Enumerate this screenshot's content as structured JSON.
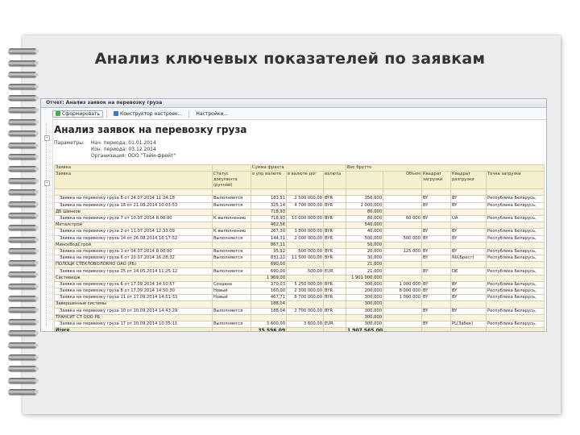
{
  "slide_title": "Анализ ключевых показателей по заявкам",
  "window": {
    "tab_prefix": "Отчет:",
    "tab_title": "Анализ заявок на перевозку груза"
  },
  "toolbar": {
    "generate_label": "Сформировать",
    "constructor_label": "Конструктор настроек...",
    "settings_label": "Настройки..."
  },
  "report": {
    "title": "Анализ заявок на перевозку груза",
    "params_label": "Параметры:",
    "params": [
      "Нач. периода: 01.01.2014",
      "Кон. периода: 03.12.2014",
      "Организация: ООО \"Тайм-фрейт\""
    ]
  },
  "table": {
    "header": {
      "c_orders": "Заявка",
      "c_order": "Заявка",
      "c_status": "Статус документа (ручной)",
      "c_freight": "Сумма фрахта",
      "c_in_agr": "в упр валюте",
      "c_in_cont": "в валюте дог",
      "c_currency": "валюта",
      "c_gross": "Вес брутто",
      "c_volume": "Объем",
      "c_load_sq": "Квадрат загрузки",
      "c_unload_sq": "Квадрат разгрузки",
      "c_load_pt": "Точка загрузки"
    },
    "rows": [
      {
        "type": "group",
        "name": "",
        "amount": "",
        "contract": "",
        "currency": "",
        "gross": "",
        "volume": "",
        "load": "",
        "unload": "",
        "point": ""
      },
      {
        "type": "item",
        "name": "Заявка на перевозку груза 8 от 24.07.2014 11:24:18",
        "status": "Выполняется",
        "amount": "183,51",
        "contract": "2 500 000,00",
        "currency": "BYR",
        "gross": "350,000",
        "volume": "",
        "load": "BY",
        "unload": "BY",
        "point": "Республика Беларусь,"
      },
      {
        "type": "item",
        "name": "Заявка на перевозку груза 16 от 21.08.2014 10:03:53",
        "status": "Выполняется",
        "amount": "325,14",
        "contract": "4 700 000,00",
        "currency": "BYR",
        "gross": "2 000,000",
        "volume": "",
        "load": "BY",
        "unload": "BY",
        "point": "Республика Беларусь,"
      },
      {
        "type": "group",
        "name": "ДБ Шенков",
        "amount": "718,93",
        "contract": "",
        "currency": "",
        "gross": "80,000",
        "volume": "",
        "load": "",
        "unload": "",
        "point": ""
      },
      {
        "type": "item",
        "name": "Заявка на перевозку груза 7 от 10.07.2014 8:00:00",
        "status": "К выполнению",
        "amount": "718,93",
        "contract": "10 000 000,00",
        "currency": "BYR",
        "gross": "80,000",
        "volume": "60 000",
        "load": "BY",
        "unload": "UA",
        "point": "Республика Беларусь,"
      },
      {
        "type": "group",
        "name": "Металстрой",
        "amount": "462,56",
        "contract": "",
        "currency": "",
        "gross": "540,000",
        "volume": "",
        "load": "",
        "unload": "",
        "point": ""
      },
      {
        "type": "item",
        "name": "Заявка на перевозку груза 2 от 11.07.2014 12:33:09",
        "status": "К выполнению",
        "amount": "267,30",
        "contract": "3 800 000,00",
        "currency": "BYR",
        "gross": "40,000",
        "volume": "",
        "load": "BY",
        "unload": "BY",
        "point": "Республика Беларусь,"
      },
      {
        "type": "item",
        "name": "Заявка на перевозку груза 14 от 26.08.2014 16:17:52",
        "status": "Выполняется",
        "amount": "144,31",
        "contract": "2 000 000,00",
        "currency": "BYR",
        "gross": "500,000",
        "volume": "500 000",
        "load": "BY",
        "unload": "BY",
        "point": "Республика Беларусь,"
      },
      {
        "type": "group",
        "name": "МинскВодСтрой",
        "amount": "867,11",
        "contract": "",
        "currency": "",
        "gross": "50,000",
        "volume": "",
        "load": "",
        "unload": "",
        "point": ""
      },
      {
        "type": "item",
        "name": "Заявка на перевозку груза 1 от 04.07.2014 8:00:00",
        "status": "Выполняется",
        "amount": "35,92",
        "contract": "500 000,00",
        "currency": "BYR",
        "gross": "20,000",
        "volume": "125 000",
        "load": "BY",
        "unload": "BY",
        "point": "Республика Беларусь,"
      },
      {
        "type": "item",
        "name": "Заявка на перевозку груза 6 от 20.07.2014 16:28:32",
        "status": "Выполняется",
        "amount": "831,22",
        "contract": "11 500 000,00",
        "currency": "BYR",
        "gross": "30,000",
        "volume": "",
        "load": "BY",
        "unload": "RU(Брест)",
        "point": "Республика Беларусь,"
      },
      {
        "type": "group",
        "name": "ПОЛОЦК СТЕКЛОВОЛОКНО ОАО (РБ)",
        "amount": "690,00",
        "contract": "",
        "currency": "",
        "gross": "21,000",
        "volume": "",
        "load": "",
        "unload": "",
        "point": ""
      },
      {
        "type": "item",
        "name": "Заявка на перевозку груза 25 от 14.05.2014 11:25:12",
        "status": "Выполняется",
        "amount": "690,00",
        "contract": "500,00",
        "currency": "EUR",
        "gross": "21,000",
        "volume": "",
        "load": "BY",
        "unload": "DE",
        "point": "Республика Беларусь,"
      },
      {
        "type": "group",
        "name": "Систевидж",
        "amount": "1 969,00",
        "contract": "",
        "currency": "",
        "gross": "1 901 000,000",
        "volume": "",
        "load": "",
        "unload": "",
        "point": ""
      },
      {
        "type": "item",
        "name": "Заявка на перевозку груза 6 от 17.09.2014 14:10:57",
        "status": "Создана",
        "amount": "370,03",
        "contract": "5 250 000,00",
        "currency": "BYR",
        "gross": "300,000",
        "volume": "1 000 000",
        "load": "BY",
        "unload": "BY",
        "point": "Республика Беларусь,"
      },
      {
        "type": "item",
        "name": "Заявка на перевозку груза 8 от 17.09.2014 14:50:30",
        "status": "Новый",
        "amount": "160,00",
        "contract": "2 300 000,00",
        "currency": "BYR",
        "gross": "200,000",
        "volume": "8 000 000",
        "load": "BY",
        "unload": "BY",
        "point": "Республика Беларусь,"
      },
      {
        "type": "item",
        "name": "Заявка на перевозку груза 11 от 17.09.2014 14:51:33",
        "status": "Новый",
        "amount": "467,71",
        "contract": "6 700 000,00",
        "currency": "BYR",
        "gross": "300,000",
        "volume": "1 000 000",
        "load": "BY",
        "unload": "BY",
        "point": "Республика Беларусь,"
      },
      {
        "type": "group",
        "name": "Завершенные системы",
        "amount": "188,04",
        "contract": "",
        "currency": "",
        "gross": "300,000",
        "volume": "",
        "load": "",
        "unload": "",
        "point": ""
      },
      {
        "type": "item",
        "name": "Заявка на перевозку груза 10 от 10.09.2014 14:43:29",
        "status": "Выполняется",
        "amount": "188,04",
        "contract": "2 700 000,00",
        "currency": "BYR",
        "gross": "300,000",
        "volume": "",
        "load": "BY",
        "unload": "BY",
        "point": "Республика Беларусь,"
      },
      {
        "type": "group",
        "name": "ТРАНСИТ СТ ООО РБ",
        "amount": "",
        "contract": "",
        "currency": "",
        "gross": "300,000",
        "volume": "",
        "load": "",
        "unload": "",
        "point": ""
      },
      {
        "type": "item",
        "name": "Заявка на перевозку груза 17 от 10.09.2014 10:35:11",
        "status": "Выполняется",
        "amount": "3 600,00",
        "contract": "3 600,00",
        "currency": "EUR",
        "gross": "300,000",
        "volume": "",
        "load": "BY",
        "unload": "PL(Забек)",
        "point": "Республика Беларусь,"
      },
      {
        "type": "total",
        "name": "Итого",
        "amount": "35 596,09",
        "contract": "",
        "currency": "",
        "gross": "1 907 565,000",
        "volume": "",
        "load": "",
        "unload": "",
        "point": ""
      }
    ]
  }
}
